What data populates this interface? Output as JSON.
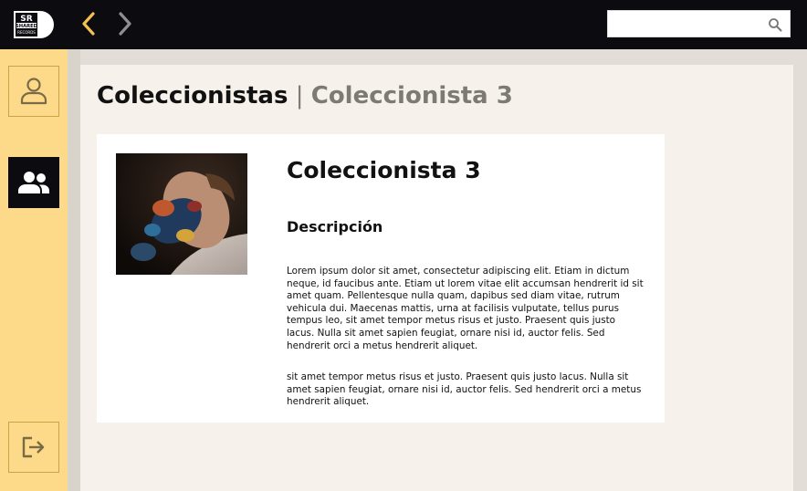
{
  "app": {
    "logo_text_top": "SR",
    "logo_text_mid": "SHARED",
    "logo_text_bottom": "RECORDS"
  },
  "topbar": {
    "back_icon": "chevron-left-icon",
    "forward_icon": "chevron-right-icon",
    "search": {
      "value": "",
      "placeholder": "",
      "icon": "search-icon"
    }
  },
  "sidebar": {
    "items": [
      {
        "icon": "user-icon",
        "active": false
      },
      {
        "icon": "users-icon",
        "active": true
      },
      {
        "icon": "logout-icon",
        "active": false
      }
    ]
  },
  "breadcrumb": {
    "root": "Coleccionistas",
    "separator": "|",
    "current": "Coleccionista 3"
  },
  "profile": {
    "name": "Coleccionista 3",
    "description_heading": "Descripción",
    "description_p1": "Lorem ipsum dolor sit amet, consectetur adipiscing elit. Etiam in dictum neque, id faucibus ante. Etiam ut lorem vitae elit accumsan hendrerit id sit amet quam. Pellentesque nulla quam, dapibus sed diam vitae, rutrum vehicula dui. Maecenas mattis, urna at facilisis vulputate, tellus purus tempus leo, sit amet tempor metus risus et justo. Praesent quis justo lacus. Nulla sit amet sapien feugiat, ornare nisi id, auctor felis. Sed hendrerit orci a metus hendrerit aliquet.",
    "description_p2": "sit amet tempor metus risus et justo. Praesent quis justo lacus. Nulla sit amet sapien feugiat, ornare nisi id, auctor felis. Sed hendrerit orci a metus hendrerit aliquet."
  },
  "colors": {
    "topbar": "#0b0b10",
    "sidebar": "#fdd98a",
    "accent": "#f2c14e",
    "panel": "#f6f1eb"
  }
}
